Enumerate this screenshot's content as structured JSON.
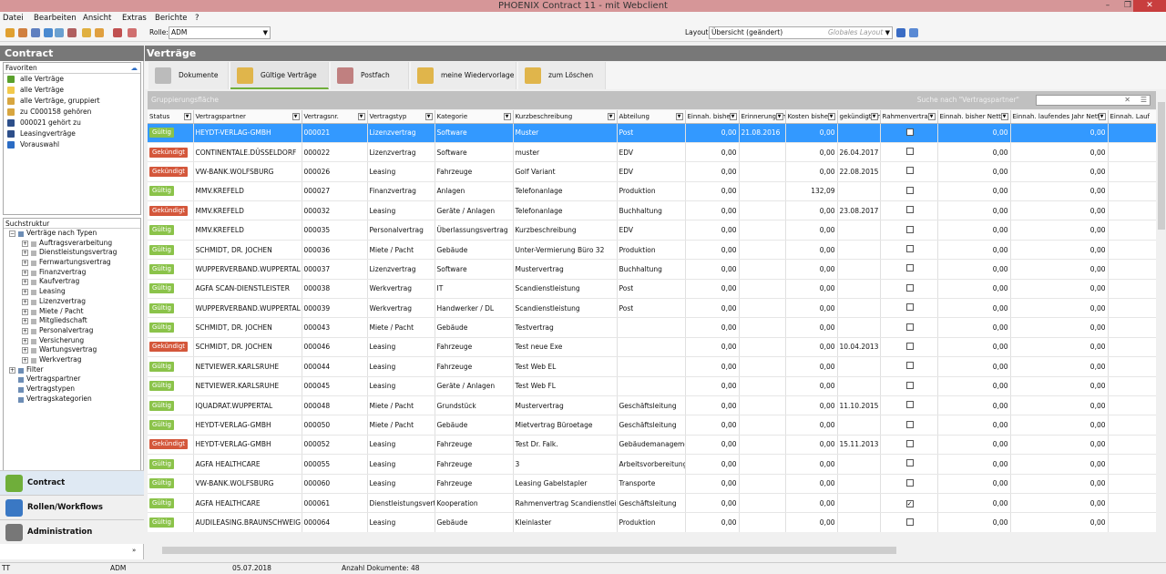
{
  "window": {
    "title": "PHOENIX Contract 11 - mit Webclient",
    "min": "–",
    "max": "❐",
    "close": "✕"
  },
  "menu": [
    "Datei",
    "Bearbeiten",
    "Ansicht",
    "Extras",
    "Berichte",
    "?"
  ],
  "toolbar": {
    "rolle_label": "Rolle:",
    "rolle_value": "ADM",
    "layout_label": "Layout:",
    "layout_value": "Übersicht (geändert)",
    "global_layout": "Globales Layout"
  },
  "sidebar": {
    "title": "Contract",
    "favorites_title": "Favoriten",
    "favorites": [
      {
        "label": "alle Verträge",
        "color": "#5aa02c"
      },
      {
        "label": "alle Verträge",
        "color": "#f2c94c"
      },
      {
        "label": "alle Verträge, gruppiert",
        "color": "#d8a640"
      },
      {
        "label": "zu C000158 gehören",
        "color": "#d8a640"
      },
      {
        "label": "000021 gehört zu",
        "color": "#2d4f8a"
      },
      {
        "label": "Leasingverträge",
        "color": "#2d4f8a"
      },
      {
        "label": "Vorauswahl",
        "color": "#2b6cc4"
      }
    ],
    "search_title": "Suchstruktur",
    "tree": [
      {
        "label": "Verträge nach Typen",
        "lvl": 0,
        "pm": "−"
      },
      {
        "label": "Auftragsverarbeitung",
        "lvl": 1,
        "pm": "+"
      },
      {
        "label": "Dienstleistungsvertrag",
        "lvl": 1,
        "pm": "+"
      },
      {
        "label": "Fernwartungsvertrag",
        "lvl": 1,
        "pm": "+"
      },
      {
        "label": "Finanzvertrag",
        "lvl": 1,
        "pm": "+"
      },
      {
        "label": "Kaufvertrag",
        "lvl": 1,
        "pm": "+"
      },
      {
        "label": "Leasing",
        "lvl": 1,
        "pm": "+"
      },
      {
        "label": "Lizenzvertrag",
        "lvl": 1,
        "pm": "+"
      },
      {
        "label": "Miete / Pacht",
        "lvl": 1,
        "pm": "+"
      },
      {
        "label": "Mitgliedschaft",
        "lvl": 1,
        "pm": "+"
      },
      {
        "label": "Personalvertrag",
        "lvl": 1,
        "pm": "+"
      },
      {
        "label": "Versicherung",
        "lvl": 1,
        "pm": "+"
      },
      {
        "label": "Wartungsvertrag",
        "lvl": 1,
        "pm": "+"
      },
      {
        "label": "Werkvertrag",
        "lvl": 1,
        "pm": "+"
      },
      {
        "label": "Filter",
        "lvl": 0,
        "pm": "+"
      },
      {
        "label": "Vertragspartner",
        "lvl": 0,
        "pm": ""
      },
      {
        "label": "Vertragstypen",
        "lvl": 0,
        "pm": ""
      },
      {
        "label": "Vertragskategorien",
        "lvl": 0,
        "pm": ""
      }
    ],
    "nav": [
      {
        "label": "Contract",
        "color": "#6fae3a"
      },
      {
        "label": "Rollen/Workflows",
        "color": "#3a78c4"
      },
      {
        "label": "Administration",
        "color": "#777777"
      }
    ]
  },
  "main": {
    "title": "Verträge",
    "group_hint": "Gruppierungsfläche",
    "search_hint": "Suche nach \"Vertragspartner\"",
    "search_clear": "✕",
    "search_menu": "☰",
    "tabs": [
      {
        "label": "Dokumente",
        "color": "#888888"
      },
      {
        "label": "Gültige Verträge",
        "color": "#e0b54b"
      },
      {
        "label": "Postfach",
        "color": "#b05050"
      },
      {
        "label": "meine Wiedervorlage",
        "color": "#e0b54b"
      },
      {
        "label": "zum Löschen",
        "color": "#e0b54b"
      }
    ],
    "columns": [
      "Status",
      "Vertragspartner",
      "Vertragsnr.",
      "Vertragstyp",
      "Kategorie",
      "Kurzbeschreibung",
      "Abteilung",
      "Einnah. bisher",
      "Erinnerung am",
      "Kosten bisher",
      "gekündigt am",
      "Rahmenvertrag",
      "Einnah. bisher Netto",
      "Einnah. laufendes Jahr Netto",
      "Einnah. Lauf"
    ],
    "status_colors": {
      "Gültig": "#8bc34a",
      "Gekündigt": "#d4573b"
    },
    "rows": [
      [
        "Gültig",
        "HEYDT-VERLAG-GMBH",
        "000021",
        "Lizenzvertrag",
        "Software",
        "Muster",
        "Post",
        "0,00",
        "21.08.2016",
        "0,00",
        "",
        false,
        "0,00",
        "0,00"
      ],
      [
        "Gekündigt",
        "CONTINENTALE.DÜSSELDORF",
        "000022",
        "Lizenzvertrag",
        "Software",
        "muster",
        "EDV",
        "0,00",
        "",
        "0,00",
        "26.04.2017",
        false,
        "0,00",
        "0,00"
      ],
      [
        "Gekündigt",
        "VW-BANK.WOLFSBURG",
        "000026",
        "Leasing",
        "Fahrzeuge",
        "Golf Variant",
        "EDV",
        "0,00",
        "",
        "0,00",
        "22.08.2015",
        false,
        "0,00",
        "0,00"
      ],
      [
        "Gültig",
        "MMV.KREFELD",
        "000027",
        "Finanzvertrag",
        "Anlagen",
        "Telefonanlage",
        "Produktion",
        "0,00",
        "",
        "132,09",
        "",
        false,
        "0,00",
        "0,00"
      ],
      [
        "Gekündigt",
        "MMV.KREFELD",
        "000032",
        "Leasing",
        "Geräte / Anlagen",
        "Telefonanlage",
        "Buchhaltung",
        "0,00",
        "",
        "0,00",
        "23.08.2017",
        false,
        "0,00",
        "0,00"
      ],
      [
        "Gültig",
        "MMV.KREFELD",
        "000035",
        "Personalvertrag",
        "Überlassungsvertrag",
        "Kurzbeschreibung",
        "EDV",
        "0,00",
        "",
        "0,00",
        "",
        false,
        "0,00",
        "0,00"
      ],
      [
        "Gültig",
        "SCHMIDT, DR. JOCHEN",
        "000036",
        "Miete / Pacht",
        "Gebäude",
        "Unter-Vermierung Büro 32",
        "Produktion",
        "0,00",
        "",
        "0,00",
        "",
        false,
        "0,00",
        "0,00"
      ],
      [
        "Gültig",
        "WUPPERVERBAND.WUPPERTAL",
        "000037",
        "Lizenzvertrag",
        "Software",
        "Mustervertrag",
        "Buchhaltung",
        "0,00",
        "",
        "0,00",
        "",
        false,
        "0,00",
        "0,00"
      ],
      [
        "Gültig",
        "AGFA SCAN-DIENSTLEISTER",
        "000038",
        "Werkvertrag",
        "IT",
        "Scandienstleistung",
        "Post",
        "0,00",
        "",
        "0,00",
        "",
        false,
        "0,00",
        "0,00"
      ],
      [
        "Gültig",
        "WUPPERVERBAND.WUPPERTAL",
        "000039",
        "Werkvertrag",
        "Handwerker / DL",
        "Scandienstleistung",
        "Post",
        "0,00",
        "",
        "0,00",
        "",
        false,
        "0,00",
        "0,00"
      ],
      [
        "Gültig",
        "SCHMIDT, DR. JOCHEN",
        "000043",
        "Miete / Pacht",
        "Gebäude",
        "Testvertrag",
        "",
        "0,00",
        "",
        "0,00",
        "",
        false,
        "0,00",
        "0,00"
      ],
      [
        "Gekündigt",
        "SCHMIDT, DR. JOCHEN",
        "000046",
        "Leasing",
        "Fahrzeuge",
        "Test neue Exe",
        "",
        "0,00",
        "",
        "0,00",
        "10.04.2013",
        false,
        "0,00",
        "0,00"
      ],
      [
        "Gültig",
        "NETVIEWER.KARLSRUHE",
        "000044",
        "Leasing",
        "Fahrzeuge",
        "Test Web EL",
        "",
        "0,00",
        "",
        "0,00",
        "",
        false,
        "0,00",
        "0,00"
      ],
      [
        "Gültig",
        "NETVIEWER.KARLSRUHE",
        "000045",
        "Leasing",
        "Geräte / Anlagen",
        "Test Web FL",
        "",
        "0,00",
        "",
        "0,00",
        "",
        false,
        "0,00",
        "0,00"
      ],
      [
        "Gültig",
        "IQUADRAT.WUPPERTAL",
        "000048",
        "Miete / Pacht",
        "Grundstück",
        "Mustervertrag",
        "Geschäftsleitung",
        "0,00",
        "",
        "0,00",
        "11.10.2015",
        false,
        "0,00",
        "0,00"
      ],
      [
        "Gültig",
        "HEYDT-VERLAG-GMBH",
        "000050",
        "Miete / Pacht",
        "Gebäude",
        "Mietvertrag Büroetage",
        "Geschäftsleitung",
        "0,00",
        "",
        "0,00",
        "",
        false,
        "0,00",
        "0,00"
      ],
      [
        "Gekündigt",
        "HEYDT-VERLAG-GMBH",
        "000052",
        "Leasing",
        "Fahrzeuge",
        "Test Dr. Falk.",
        "Gebäudemanagement",
        "0,00",
        "",
        "0,00",
        "15.11.2013",
        false,
        "0,00",
        "0,00"
      ],
      [
        "Gültig",
        "AGFA HEALTHCARE",
        "000055",
        "Leasing",
        "Fahrzeuge",
        "3",
        "Arbeitsvorbereitung",
        "0,00",
        "",
        "0,00",
        "",
        false,
        "0,00",
        "0,00"
      ],
      [
        "Gültig",
        "VW-BANK.WOLFSBURG",
        "000060",
        "Leasing",
        "Fahrzeuge",
        "Leasing Gabelstapler",
        "Transporte",
        "0,00",
        "",
        "0,00",
        "",
        false,
        "0,00",
        "0,00"
      ],
      [
        "Gültig",
        "AGFA HEALTHCARE",
        "000061",
        "Dienstleistungsvertrag",
        "Kooperation",
        "Rahmenvertrag Scandienstleistung",
        "Geschäftsleitung",
        "0,00",
        "",
        "0,00",
        "",
        true,
        "0,00",
        "0,00"
      ],
      [
        "Gültig",
        "AUDILEASING.BRAUNSCHWEIG",
        "000064",
        "Leasing",
        "Gebäude",
        "Kleinlaster",
        "Produktion",
        "0,00",
        "",
        "0,00",
        "",
        false,
        "0,00",
        "0,00"
      ]
    ]
  },
  "statusbar": {
    "tt": "TT",
    "user": "ADM",
    "date": "05.07.2018",
    "count": "Anzahl Dokumente: 48"
  }
}
